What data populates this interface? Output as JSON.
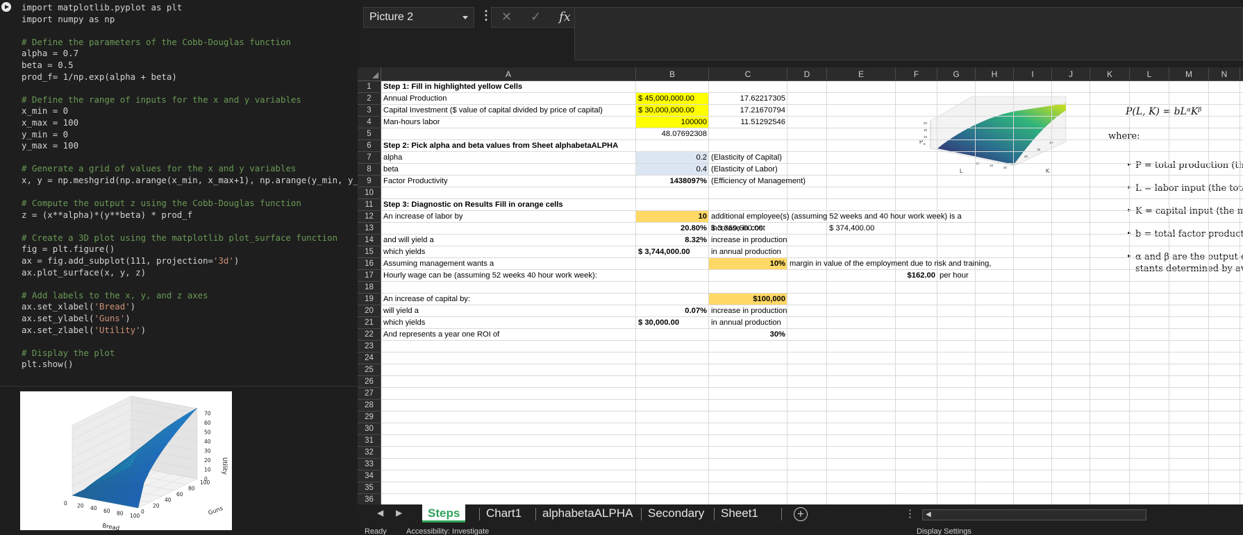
{
  "code": {
    "lines": [
      {
        "t": "import matplotlib.pyplot as plt",
        "k": "kw"
      },
      {
        "t": "import numpy as np",
        "k": "kw"
      },
      {
        "t": "",
        "k": "kw"
      },
      {
        "t": "# Define the parameters of the Cobb-Douglas function",
        "k": "comment"
      },
      {
        "t": "alpha = 0.7",
        "k": "kw"
      },
      {
        "t": "beta = 0.5",
        "k": "kw"
      },
      {
        "t": "prod_f= 1/np.exp(alpha + beta)",
        "k": "kw"
      },
      {
        "t": "",
        "k": "kw"
      },
      {
        "t": "# Define the range of inputs for the x and y variables",
        "k": "comment"
      },
      {
        "t": "x_min = 0",
        "k": "kw"
      },
      {
        "t": "x_max = 100",
        "k": "kw"
      },
      {
        "t": "y_min = 0",
        "k": "kw"
      },
      {
        "t": "y_max = 100",
        "k": "kw"
      },
      {
        "t": "",
        "k": "kw"
      },
      {
        "t": "# Generate a grid of values for the x and y variables",
        "k": "comment"
      },
      {
        "t": "x, y = np.meshgrid(np.arange(x_min, x_max+1), np.arange(y_min, y_max+",
        "k": "kw"
      },
      {
        "t": "",
        "k": "kw"
      },
      {
        "t": "# Compute the output z using the Cobb-Douglas function",
        "k": "comment"
      },
      {
        "t": "z = (x**alpha)*(y**beta) * prod_f",
        "k": "kw"
      },
      {
        "t": "",
        "k": "kw"
      },
      {
        "t": "# Create a 3D plot using the matplotlib plot_surface function",
        "k": "comment"
      },
      {
        "t": "fig = plt.figure()",
        "k": "kw"
      },
      {
        "t": "ax = fig.add_subplot(111, projection='3d')",
        "k": "mix",
        "pre": "ax = fig.add_subplot(111, projection=",
        "str": "'3d'",
        "post": ")"
      },
      {
        "t": "ax.plot_surface(x, y, z)",
        "k": "kw"
      },
      {
        "t": "",
        "k": "kw"
      },
      {
        "t": "# Add labels to the x, y, and z axes",
        "k": "comment"
      },
      {
        "t": "ax.set_xlabel('Bread')",
        "k": "mix",
        "pre": "ax.set_xlabel(",
        "str": "'Bread'",
        "post": ")"
      },
      {
        "t": "ax.set_ylabel('Guns')",
        "k": "mix",
        "pre": "ax.set_ylabel(",
        "str": "'Guns'",
        "post": ")"
      },
      {
        "t": "ax.set_zlabel('Utility')",
        "k": "mix",
        "pre": "ax.set_zlabel(",
        "str": "'Utility'",
        "post": ")"
      },
      {
        "t": "",
        "k": "kw"
      },
      {
        "t": "# Display the plot",
        "k": "comment"
      },
      {
        "t": "plt.show()",
        "k": "kw"
      }
    ]
  },
  "plot": {
    "xlabel": "Bread",
    "ylabel": "Guns",
    "zlabel": "Utility",
    "x_ticks": [
      "0",
      "20",
      "40",
      "60",
      "80",
      "100"
    ],
    "y_ticks": [
      "0",
      "20",
      "40",
      "60",
      "80",
      "100"
    ],
    "z_ticks": [
      "0",
      "10",
      "20",
      "30",
      "40",
      "50",
      "60",
      "70"
    ]
  },
  "excel": {
    "name_box": "Picture 2",
    "fx_label": "fx",
    "cancel_glyph": "✕",
    "enter_glyph": "✓",
    "more_glyph": "⋮",
    "columns": [
      "A",
      "B",
      "C",
      "D",
      "E",
      "F",
      "G",
      "H",
      "I",
      "J",
      "K",
      "L",
      "M",
      "N"
    ],
    "rows": [
      "1",
      "2",
      "3",
      "4",
      "5",
      "6",
      "7",
      "8",
      "9",
      "10",
      "11",
      "12",
      "13",
      "14",
      "15",
      "16",
      "17",
      "18",
      "19",
      "20",
      "21",
      "22",
      "23",
      "24",
      "25",
      "26",
      "27",
      "28",
      "29",
      "30",
      "31",
      "32",
      "33",
      "34",
      "35",
      "36"
    ],
    "cells": [
      {
        "r": 1,
        "c": "A",
        "v": "Step 1: Fill in highlighted yellow Cells",
        "b": true
      },
      {
        "r": 2,
        "c": "A",
        "v": "Annual Production"
      },
      {
        "r": 2,
        "c": "B",
        "v": "$   45,000,000.00"
      },
      {
        "r": 2,
        "c": "C",
        "v": "17.62217305",
        "a": "right"
      },
      {
        "r": 3,
        "c": "A",
        "v": "Capital Investment ($ value of capital divided by price of capital)"
      },
      {
        "r": 3,
        "c": "B",
        "v": "$   30,000,000.00"
      },
      {
        "r": 3,
        "c": "C",
        "v": "17.21670794",
        "a": "right"
      },
      {
        "r": 4,
        "c": "A",
        "v": "Man-hours labor"
      },
      {
        "r": 4,
        "c": "B",
        "v": "100000",
        "a": "right"
      },
      {
        "r": 4,
        "c": "C",
        "v": "11.51292546",
        "a": "right"
      },
      {
        "r": 5,
        "c": "B",
        "v": "48.07692308",
        "a": "right"
      },
      {
        "r": 6,
        "c": "A",
        "v": "Step 2: Pick alpha and beta values from Sheet alphabetaALPHA",
        "b": true
      },
      {
        "r": 7,
        "c": "A",
        "v": "alpha"
      },
      {
        "r": 7,
        "c": "B",
        "v": "0.2",
        "a": "right"
      },
      {
        "r": 7,
        "c": "C",
        "v": "(Elasticity of Capital)"
      },
      {
        "r": 8,
        "c": "A",
        "v": "beta"
      },
      {
        "r": 8,
        "c": "B",
        "v": "0.4",
        "a": "right"
      },
      {
        "r": 8,
        "c": "C",
        "v": "(Elasticity of Labor)"
      },
      {
        "r": 9,
        "c": "A",
        "v": "Factor Productivity"
      },
      {
        "r": 9,
        "c": "B",
        "v": "1438097%",
        "a": "right",
        "b": true
      },
      {
        "r": 9,
        "c": "C",
        "v": "(Efficiency of Management)"
      },
      {
        "r": 11,
        "c": "A",
        "v": "Step 3: Diagnostic on Results Fill in orange cells",
        "b": true
      },
      {
        "r": 12,
        "c": "A",
        "v": "An increase of labor by"
      },
      {
        "r": 12,
        "c": "B",
        "v": "10",
        "a": "right",
        "b": true
      },
      {
        "r": 12,
        "c": "C",
        "v": "additional employee(s) (assuming 52 weeks and 40 hour work week) is a"
      },
      {
        "r": 13,
        "c": "B",
        "v": "20.80%",
        "a": "right",
        "b": true
      },
      {
        "r": 13,
        "c": "B2",
        "v": "increase in cost"
      },
      {
        "r": 13,
        "c": "C",
        "v": "$          3,369,600.00"
      },
      {
        "r": 13,
        "c": "E",
        "v": "$      374,400.00"
      },
      {
        "r": 14,
        "c": "A",
        "v": "and will yield a"
      },
      {
        "r": 14,
        "c": "B",
        "v": "8.32%",
        "a": "right",
        "b": true
      },
      {
        "r": 14,
        "c": "C",
        "v": "increase in production"
      },
      {
        "r": 15,
        "c": "A",
        "v": "which yields"
      },
      {
        "r": 15,
        "c": "B",
        "v": "$    3,744,000.00",
        "b": true
      },
      {
        "r": 15,
        "c": "C",
        "v": "in annual production"
      },
      {
        "r": 16,
        "c": "A",
        "v": "Assuming management wants a"
      },
      {
        "r": 16,
        "c": "C",
        "v": "10%",
        "a": "right",
        "b": true
      },
      {
        "r": 16,
        "c": "D",
        "v": "margin in value of the employment due to risk and training,"
      },
      {
        "r": 17,
        "c": "A",
        "v": "Hourly wage can be (assuming 52 weeks 40 hour work week):"
      },
      {
        "r": 17,
        "c": "F",
        "v": "$162.00",
        "a": "right",
        "b": true
      },
      {
        "r": 17,
        "c": "G",
        "v": "per hour"
      },
      {
        "r": 19,
        "c": "A",
        "v": "An increase of capital by:"
      },
      {
        "r": 19,
        "c": "C",
        "v": "$100,000",
        "a": "right",
        "b": true
      },
      {
        "r": 20,
        "c": "A",
        "v": "will yield a"
      },
      {
        "r": 20,
        "c": "B",
        "v": "0.07%",
        "a": "right",
        "b": true
      },
      {
        "r": 20,
        "c": "C",
        "v": "increase in production"
      },
      {
        "r": 21,
        "c": "A",
        "v": "which yields"
      },
      {
        "r": 21,
        "c": "B",
        "v": "$           30,000.00",
        "b": true
      },
      {
        "r": 21,
        "c": "C",
        "v": "in annual production"
      },
      {
        "r": 22,
        "c": "A",
        "v": "And represents a year one ROI of"
      },
      {
        "r": 22,
        "c": "C",
        "v": "30%",
        "a": "right",
        "b": true
      }
    ],
    "fills": [
      {
        "r": 2,
        "c": "B",
        "color": "#ffff00"
      },
      {
        "r": 3,
        "c": "B",
        "color": "#ffff00"
      },
      {
        "r": 4,
        "c": "B",
        "color": "#ffff00"
      },
      {
        "r": 7,
        "c": "B",
        "color": "#dce6f2"
      },
      {
        "r": 8,
        "c": "B",
        "color": "#dce6f2"
      },
      {
        "r": 12,
        "c": "B",
        "color": "#ffd966"
      },
      {
        "r": 16,
        "c": "C",
        "color": "#ffd966"
      },
      {
        "r": 19,
        "c": "C",
        "color": "#ffd966"
      }
    ],
    "chart": {
      "z_label": "P",
      "x_label": "L",
      "y_label": "K",
      "z_ticks": [
        "20",
        "15",
        "10",
        "5"
      ],
      "y_ticks": [
        "20",
        "15",
        "10"
      ],
      "x_ticks": [
        "10",
        "15",
        "20"
      ]
    },
    "math": {
      "formula": "P(L, K) = bLᵅKᵝ",
      "where": "where:",
      "bullets": [
        "P = total production (the",
        "L = labor input (the total",
        "K = capital input (the mo",
        "b = total factor productivi",
        "α and β are the output el"
      ],
      "bullet_cont": "stants determined by avai"
    },
    "tabs": [
      "Steps",
      "Chart1",
      "alphabetaALPHA",
      "Secondary",
      "Sheet1"
    ],
    "add_sheet": "+",
    "status_ready": "Ready",
    "status_access": "Accessibility: Investigate",
    "status_display": "Display Settings"
  }
}
